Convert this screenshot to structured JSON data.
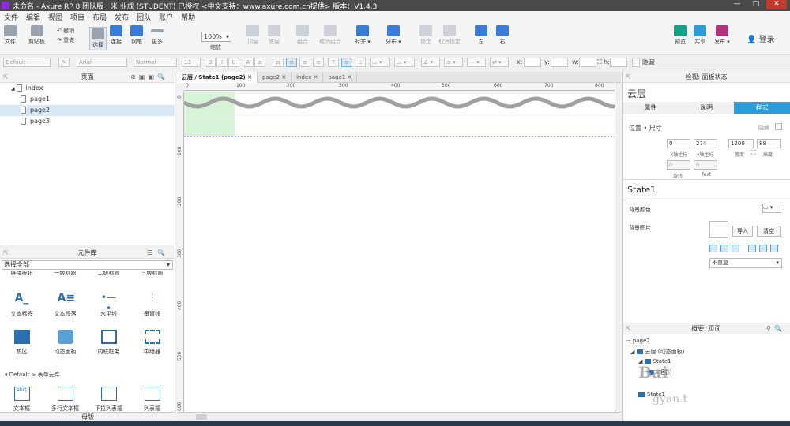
{
  "titlebar": {
    "title": "未命名 - Axure RP 8 团队版 : 米 业成 (STUDENT) 已授权    <中文支持：www.axure.com.cn提供> 版本：V1.4.3",
    "min": "—",
    "max": "□",
    "close": "✕"
  },
  "menu": [
    "文件",
    "编辑",
    "视图",
    "项目",
    "布局",
    "发布",
    "团队",
    "账户",
    "帮助"
  ],
  "toolbar": {
    "file": "文件",
    "clipboard": "剪贴板",
    "undo": "撤销",
    "redo": "重做",
    "select": "选择",
    "connect": "连接",
    "pen": "钢笔",
    "more": "更多",
    "zoom_value": "100%",
    "zoom_label": "缩放",
    "top": "顶层",
    "bottom": "底层",
    "group": "组合",
    "ungroup": "取消组合",
    "align": "对齐",
    "distribute": "分布",
    "lock": "锁定",
    "unlock": "取消锁定",
    "left": "左",
    "right": "右",
    "preview": "预览",
    "share": "共享",
    "publish": "发布",
    "login": "登录"
  },
  "stylebar": {
    "style": "Default",
    "font": "Arial",
    "weight": "Normal",
    "size": "13",
    "x_label": "x:",
    "y_label": "y:",
    "w_label": "w:",
    "h_label": "h:",
    "hidden": "隐藏"
  },
  "pages": {
    "title": "页面",
    "root": "index",
    "items": [
      "page1",
      "page2",
      "page3"
    ]
  },
  "library": {
    "title": "元件库",
    "selector": "选择全部",
    "partial_row": [
      "链接按钮",
      "一级标题",
      "二级标题",
      "三级标题"
    ],
    "row1": [
      "文本标签",
      "文本段落",
      "水平线",
      "垂直线"
    ],
    "row2": [
      "热区",
      "动态面板",
      "内联框架",
      "中继器"
    ],
    "section": "Default > 表单元件",
    "row3": [
      "文本框",
      "多行文本框",
      "下拉列表框",
      "列表框"
    ],
    "bottom_tab": "母版"
  },
  "canvas": {
    "tabs": [
      "云层 / State1 (page2)",
      "page2",
      "index",
      "page1"
    ],
    "ruler_h": [
      "0",
      "100",
      "200",
      "300",
      "400",
      "500",
      "600",
      "700",
      "800"
    ],
    "ruler_v": [
      "0",
      "100",
      "200",
      "300",
      "400",
      "500",
      "600"
    ],
    "wave_color": "#a0a0a0",
    "highlight_color": "#c8f0c8"
  },
  "inspector": {
    "header": "检视: 面板状态",
    "title": "云层",
    "tabs": [
      "属性",
      "说明",
      "样式"
    ],
    "section_pos": "位置 • 尺寸",
    "hidden": "隐藏",
    "x": "0",
    "y": "274",
    "w": "1200",
    "h": "88",
    "x_label": "X轴坐标",
    "y_label": "y轴坐标",
    "w_label": "宽度",
    "h_label": "高度",
    "rot": "0",
    "text_rot": "0",
    "rot_label": "旋转",
    "text_label": "Text",
    "state_name": "State1",
    "bg_color_label": "背景颜色",
    "bg_image_label": "背景图片",
    "import": "导入",
    "clear": "清空",
    "repeat": "不重复"
  },
  "outline": {
    "title": "概要: 页面",
    "page": "page2",
    "panel": "云层 (动态面板)",
    "state1a": "State1",
    "state1b": "State1",
    "shape": "(矩形)"
  },
  "watermark": "Bai",
  "watermark_sub": "gyan.t"
}
